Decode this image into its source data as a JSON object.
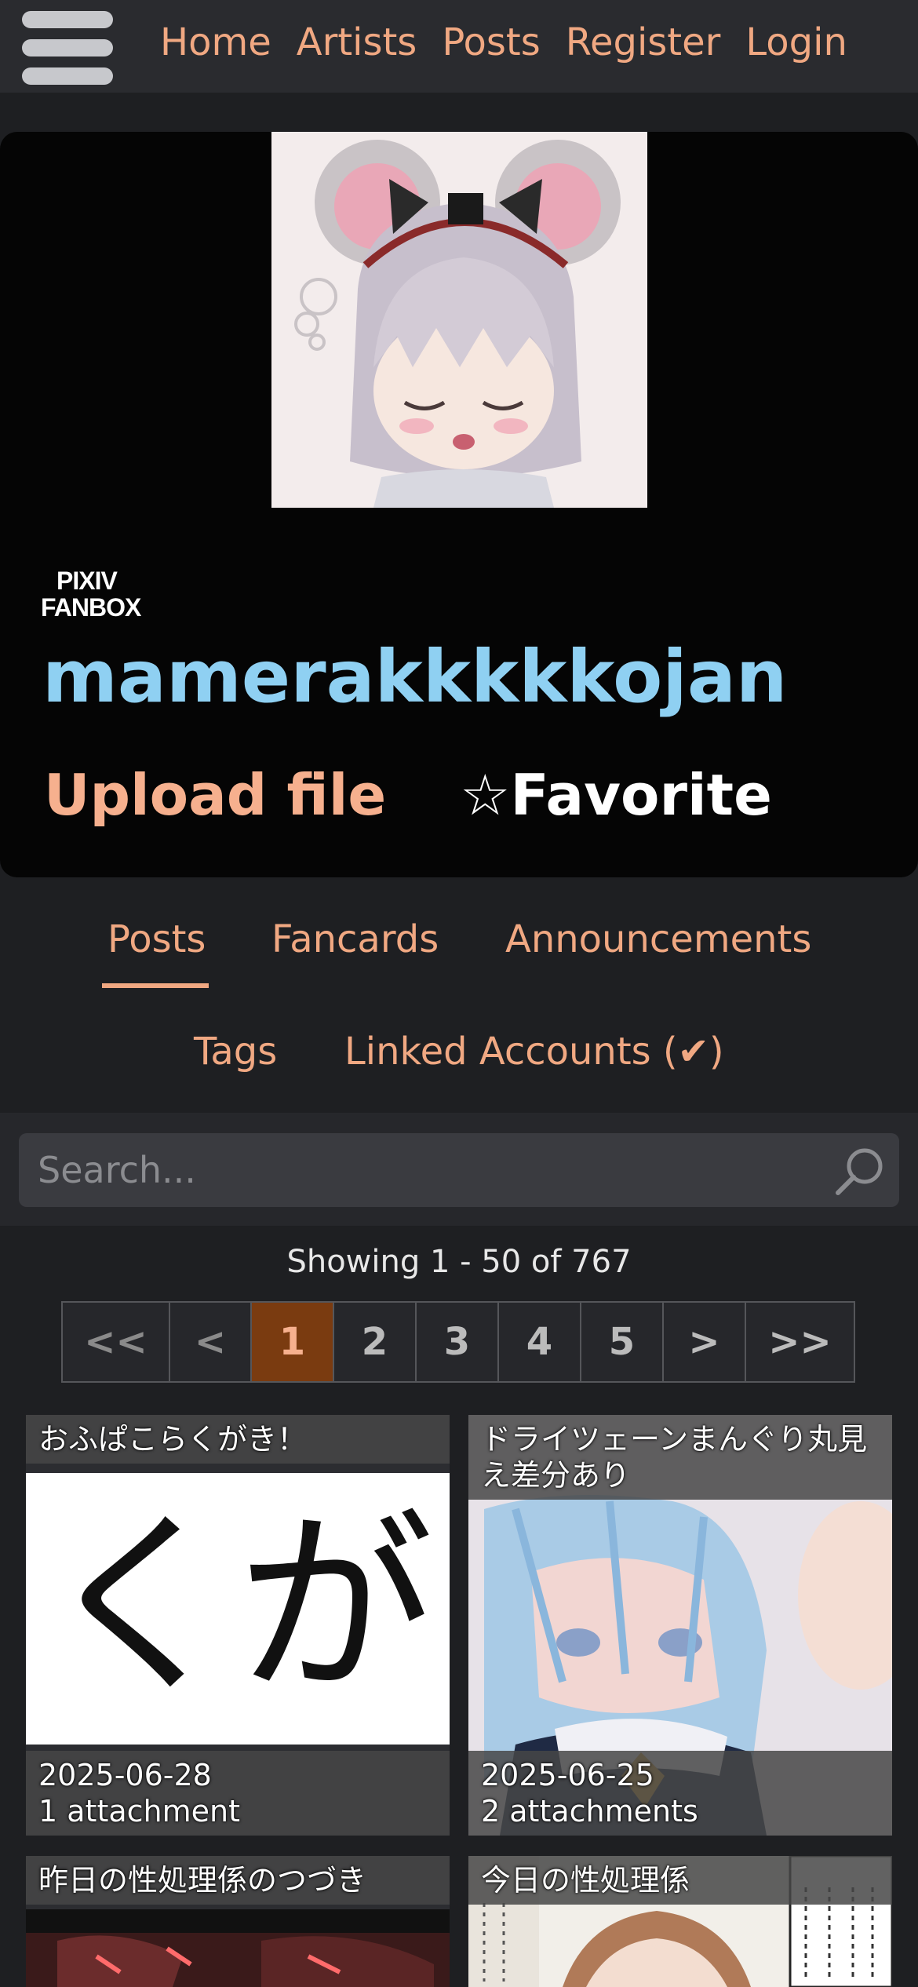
{
  "nav": {
    "items": [
      "Home",
      "Artists",
      "Posts",
      "Register",
      "Login"
    ]
  },
  "artist": {
    "service": "PIXIV FANBOX",
    "service_line1": "PIXIV",
    "service_line2": "FANBOX",
    "name": "mamerakkkkkojan",
    "upload_label": "Upload file",
    "favorite_label": "☆Favorite"
  },
  "tabs": {
    "posts": "Posts",
    "fancards": "Fancards",
    "announcements": "Announcements",
    "tags": "Tags",
    "linked": "Linked Accounts (✔)"
  },
  "search": {
    "placeholder": "Search..."
  },
  "pagination": {
    "showing": "Showing 1 - 50 of 767",
    "first": "<<",
    "prev": "<",
    "pages": [
      "1",
      "2",
      "3",
      "4",
      "5"
    ],
    "current": "1",
    "next": ">",
    "last": ">>"
  },
  "posts": [
    {
      "title": "おふぱこらくがき！",
      "date": "2025-06-28",
      "attachments": "1 attachment",
      "thumb_text": "くが"
    },
    {
      "title": "ドライツェーンまんぐり丸見え差分あり",
      "date": "2025-06-25",
      "attachments": "2 attachments"
    },
    {
      "title": "昨日の性処理係のつづき"
    },
    {
      "title": "今日の性処理係"
    }
  ],
  "colors": {
    "accent": "#f0a882",
    "artist_name": "#8fd0f2",
    "background": "#1e1f22",
    "card": "#050505"
  }
}
